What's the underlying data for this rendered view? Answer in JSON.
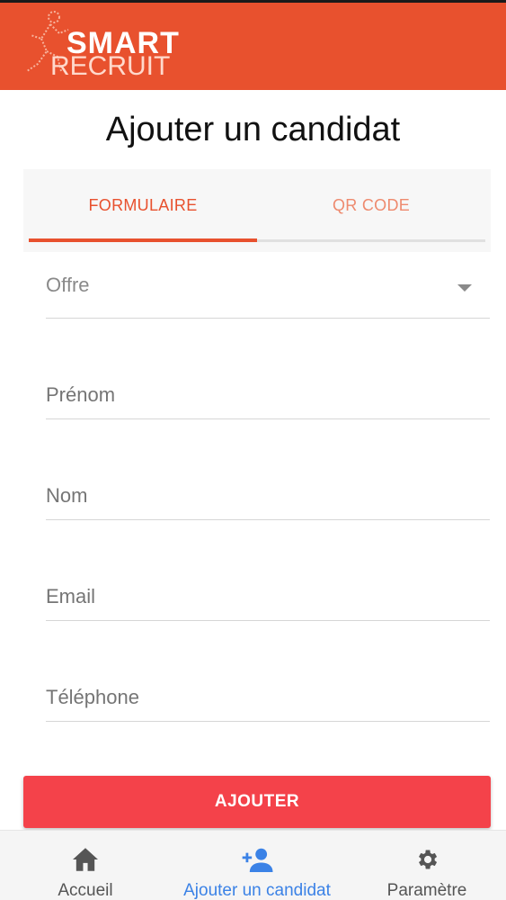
{
  "header": {
    "logo_smart": "SMART",
    "logo_recruit": "RECRUIT",
    "background_color": "#e8512e"
  },
  "page": {
    "title": "Ajouter un candidat"
  },
  "tabs": [
    {
      "label": "FORMULAIRE",
      "active": true
    },
    {
      "label": "QR CODE",
      "active": false
    }
  ],
  "form": {
    "offre_label": "Offre",
    "prenom_placeholder": "Prénom",
    "nom_placeholder": "Nom",
    "email_placeholder": "Email",
    "telephone_placeholder": "Téléphone"
  },
  "actions": {
    "submit_label": "AJOUTER",
    "submit_color": "#f4424a"
  },
  "bottom_nav": [
    {
      "label": "Accueil",
      "icon": "home-icon",
      "active": false
    },
    {
      "label": "Ajouter un candidat",
      "icon": "person-add-icon",
      "active": true
    },
    {
      "label": "Paramètre",
      "icon": "gear-icon",
      "active": false
    }
  ],
  "colors": {
    "accent": "#e8512e",
    "nav_active": "#3b82e6"
  }
}
